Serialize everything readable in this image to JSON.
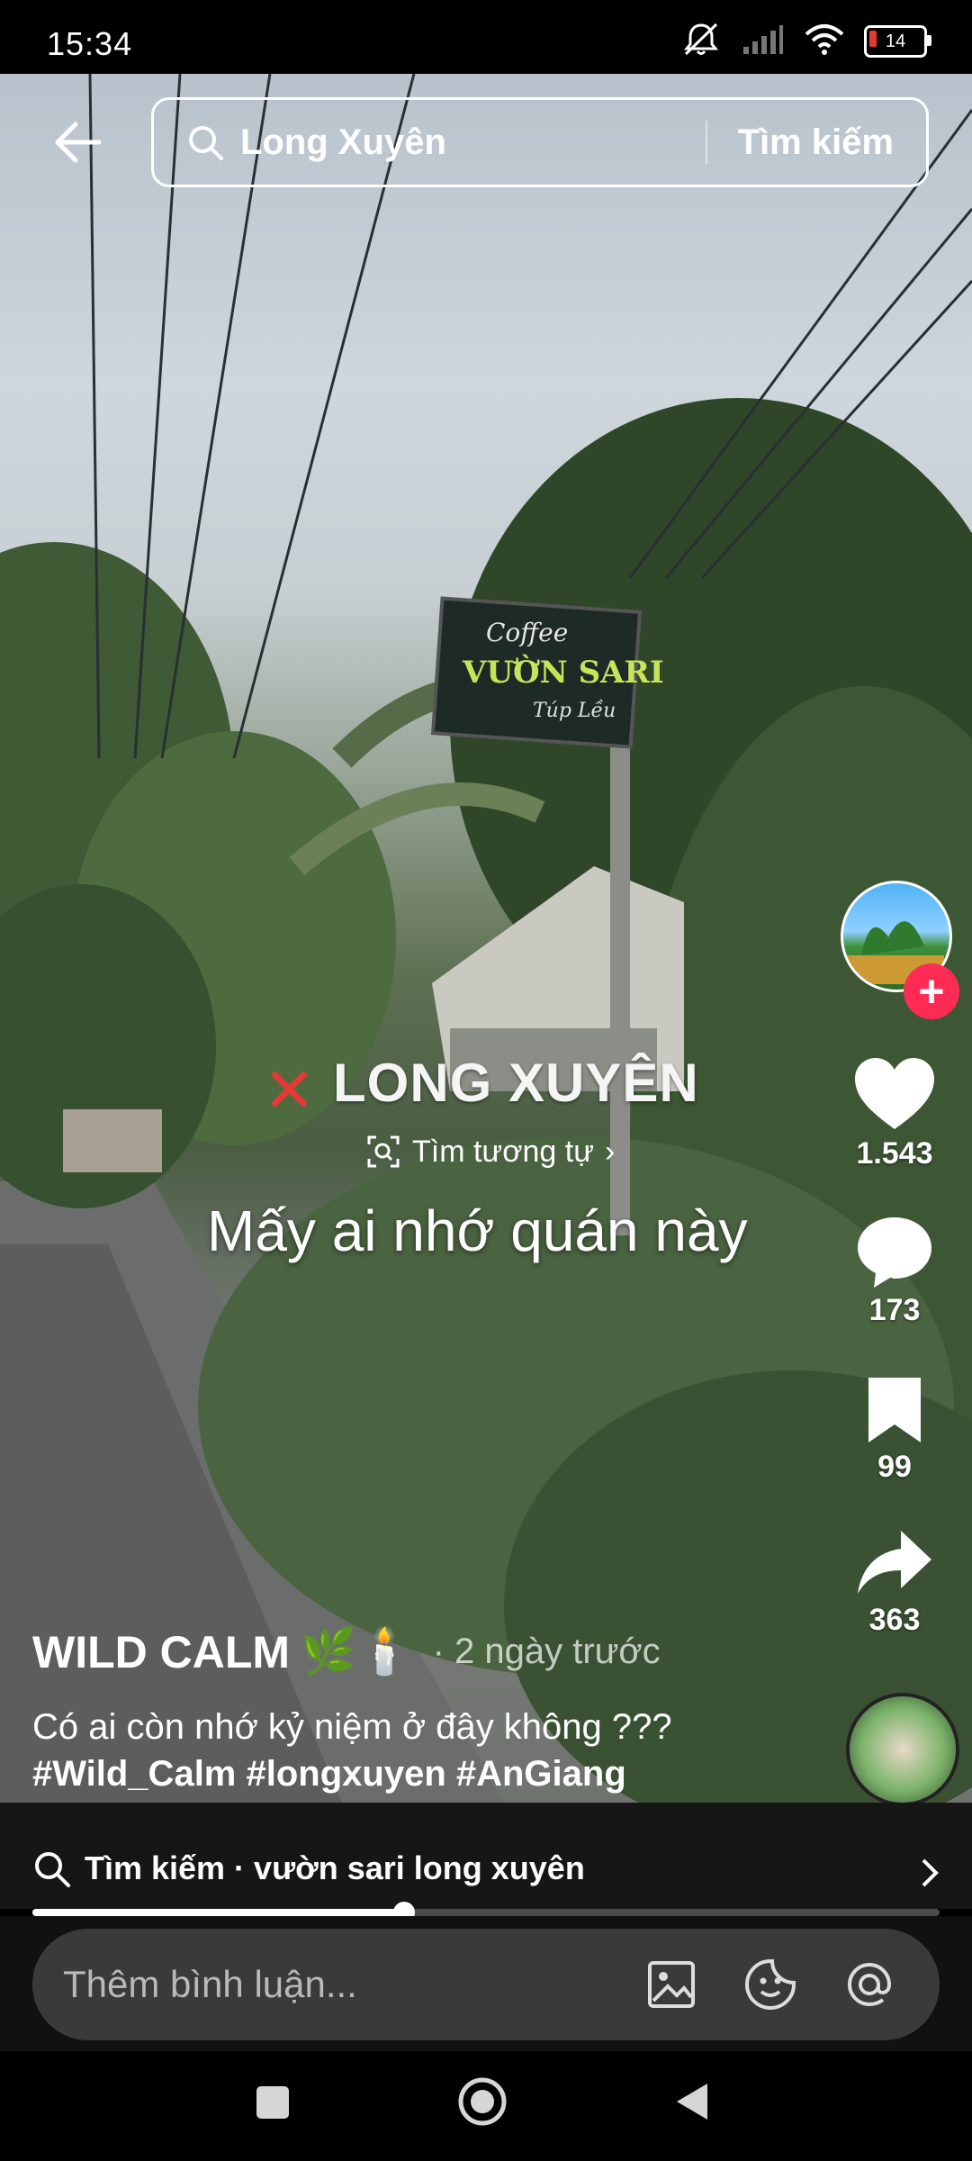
{
  "status_bar": {
    "time": "15:34",
    "battery_level": "14",
    "icons": [
      "mute-icon",
      "signal-icon",
      "wifi-icon",
      "battery-icon"
    ]
  },
  "top_search": {
    "query": "Long Xuyên",
    "action_label": "Tìm kiếm"
  },
  "video_overlay": {
    "title": "LONG XUYÊN",
    "find_similar_label": "Tìm tương tự",
    "caption": "Mấy ai nhớ quán này"
  },
  "rail": {
    "likes": "1.543",
    "comments": "173",
    "saves": "99",
    "shares": "363",
    "follow_symbol": "+"
  },
  "post": {
    "author": "WILD CALM",
    "author_emoji": "🌿🕯️",
    "time_ago": "· 2 ngày trước",
    "description": "Có ai còn nhớ kỷ niệm ở đây không ???",
    "hashtags": "#Wild_Calm #longxuyen #AnGiang"
  },
  "search_suggestion": {
    "text": "Tìm kiếm · vườn sari long xuyên"
  },
  "playback": {
    "progress": 0.41
  },
  "comment_bar": {
    "placeholder": "Thêm bình luận..."
  },
  "colors": {
    "accent_red": "#fe2c55",
    "background": "#000000"
  }
}
